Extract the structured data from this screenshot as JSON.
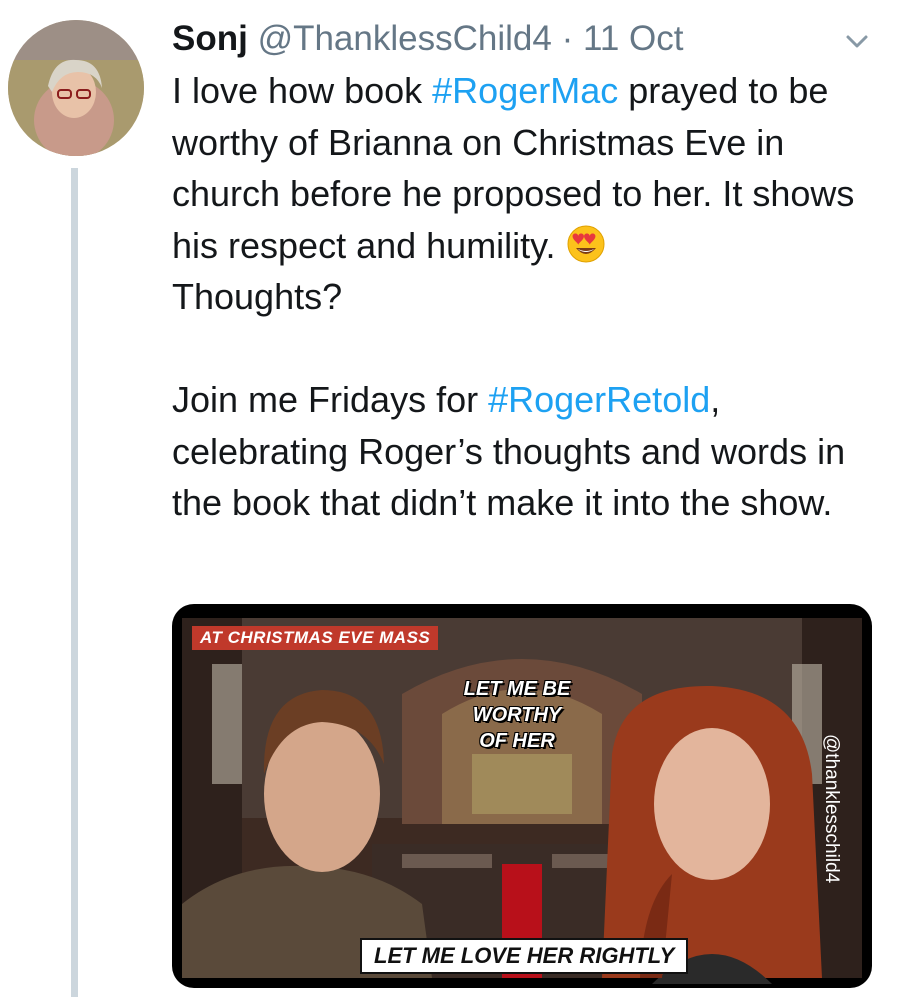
{
  "tweet": {
    "display_name": "Sonj",
    "handle": "@ThanklessChild4",
    "separator": "·",
    "timestamp": "11 Oct",
    "menu_icon": "chevron-down-icon",
    "paragraph1": {
      "before": "I love how book ",
      "hashtag": "#RogerMac",
      "after": " prayed to be worthy of Brianna on Christmas Eve in church before he proposed to her. It shows his respect and humility. ",
      "emoji": "heart-eyes-emoji-icon",
      "end": "Thoughts?"
    },
    "paragraph2": {
      "before": "Join me Fridays for ",
      "hashtag": "#RogerRetold",
      "after": ", celebrating Roger’s thoughts and words in the book that didn’t make it into the show."
    }
  },
  "media": {
    "caption_top": "AT CHRISTMAS EVE MASS",
    "bubble_lines": [
      "LET ME BE",
      "WORTHY",
      "OF HER"
    ],
    "caption_bottom": "LET ME LOVE HER RIGHTLY",
    "watermark": "@thanklesschild4"
  },
  "colors": {
    "hashtag": "#1da1f2",
    "secondary_text": "#657786",
    "thread_line": "#ccd6dd"
  }
}
